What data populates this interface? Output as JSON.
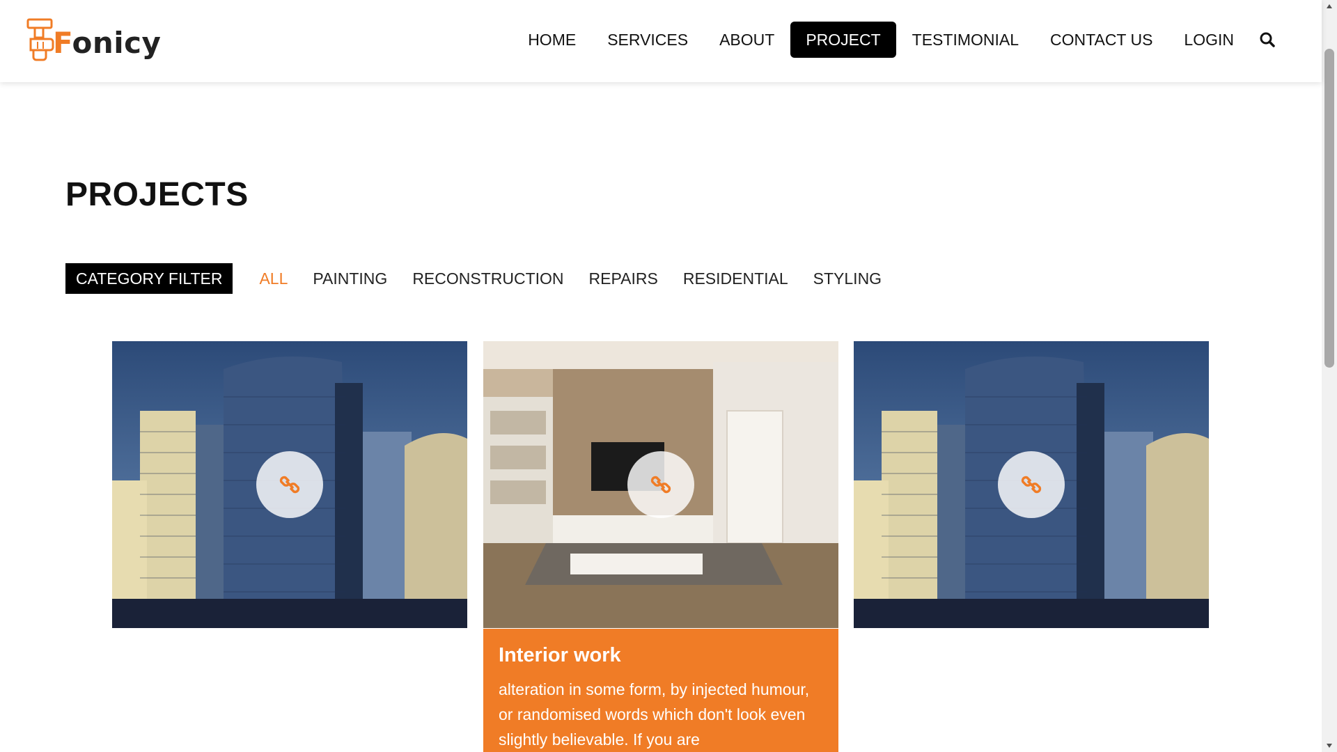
{
  "brand": {
    "name_first": "F",
    "name_rest": "onicy"
  },
  "nav": {
    "items": [
      {
        "label": "HOME"
      },
      {
        "label": "SERVICES"
      },
      {
        "label": "ABOUT"
      },
      {
        "label": "PROJECT",
        "active": true
      },
      {
        "label": "TESTIMONIAL"
      },
      {
        "label": "CONTACT US"
      },
      {
        "label": "LOGIN"
      }
    ],
    "search_icon": "search-icon"
  },
  "page": {
    "title": "PROJECTS"
  },
  "filter": {
    "label": "CATEGORY FILTER",
    "items": [
      "ALL",
      "PAINTING",
      "RECONSTRUCTION",
      "REPAIRS",
      "RESIDENTIAL",
      "STYLING"
    ],
    "active": "ALL"
  },
  "projects": [
    {
      "image": "office-buildings",
      "icon": "link-icon"
    },
    {
      "image": "living-room-interior",
      "icon": "link-icon",
      "title": "Interior work",
      "description": "alteration in some form, by injected humour, or randomised words which don't look even slightly believable. If you are"
    },
    {
      "image": "office-buildings",
      "icon": "link-icon"
    }
  ],
  "colors": {
    "accent": "#f07c26",
    "dark": "#000000",
    "text": "#111111"
  }
}
